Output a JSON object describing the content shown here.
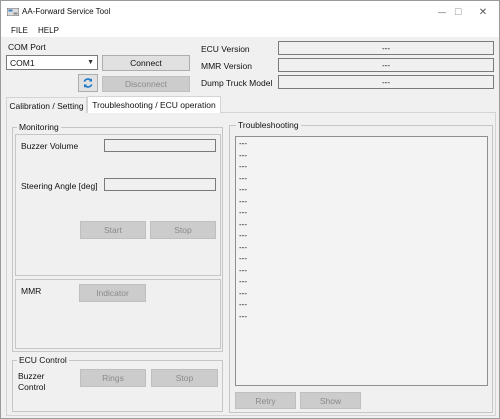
{
  "window": {
    "title": "AA-Forward Service Tool",
    "controls": {
      "minimize": "—",
      "maximize": "☐",
      "close": "✕"
    }
  },
  "menu": {
    "file": "FILE",
    "help": "HELP"
  },
  "connection": {
    "com_port_label": "COM Port",
    "com_port_value": "COM1",
    "connect_label": "Connect",
    "disconnect_label": "Disconnect"
  },
  "info": {
    "ecu_version_label": "ECU Version",
    "ecu_version_value": "---",
    "mmr_version_label": "MMR Version",
    "mmr_version_value": "---",
    "truck_model_label": "Dump Truck Model",
    "truck_model_value": "---"
  },
  "tabs": [
    {
      "label": "Calibration / Setting",
      "active": false
    },
    {
      "label": "Troubleshooting / ECU operation",
      "active": true
    }
  ],
  "monitoring": {
    "title": "Monitoring",
    "buzzer_volume_label": "Buzzer Volume",
    "buzzer_volume_value": "",
    "steering_angle_label": "Steering Angle [deg]",
    "steering_angle_value": "",
    "start_label": "Start",
    "stop_label": "Stop"
  },
  "mmr": {
    "label": "MMR",
    "indicator_label": "Indicator"
  },
  "ecu_control": {
    "title": "ECU Control",
    "buzzer_label_line1": "Buzzer",
    "buzzer_label_line2": "Control",
    "rings_label": "Rings",
    "stop_label": "Stop"
  },
  "troubleshooting": {
    "title": "Troubleshooting",
    "lines": [
      "---",
      "---",
      "---",
      "---",
      "---",
      "---",
      "---",
      "---",
      "---",
      "---",
      "---",
      "---",
      "---",
      "---",
      "---",
      "---"
    ],
    "retry_label": "Retry",
    "show_label": "Show"
  },
  "colors": {
    "window_bg": "#f0f0f0",
    "titlebar_bg": "#ffffff",
    "button_bg": "#e1e1e1",
    "disabled_button_bg": "#cccccc",
    "disabled_text": "#8a8a8a",
    "refresh_icon": "#1e78c8"
  },
  "icons": {
    "app": "app-icon",
    "refresh": "refresh-icon",
    "dropdown": "chevron-down-icon"
  }
}
